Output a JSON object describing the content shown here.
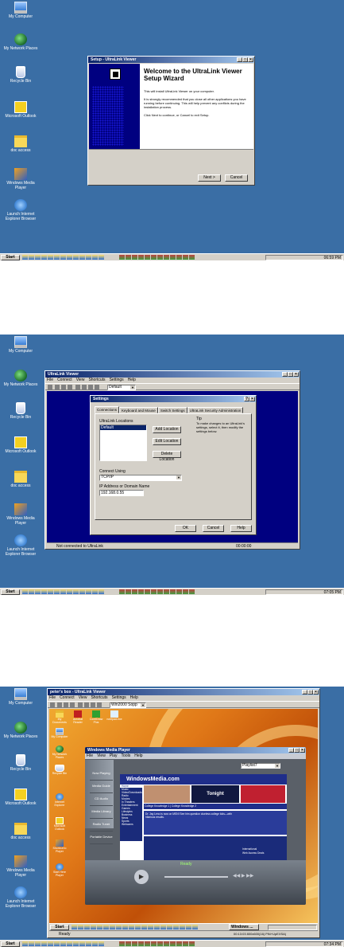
{
  "desktop_icons": [
    "My Computer",
    "My Network Places",
    "Recycle Bin",
    "Microsoft Outlook",
    "doc access",
    "Windows Media Player",
    "Launch Internet Explorer Browser"
  ],
  "taskbar": {
    "start_label": "Start"
  },
  "shot1": {
    "clock": "06:59 PM",
    "wizard": {
      "title": "Setup - UltraLink Viewer",
      "heading": "Welcome to the UltraLink Viewer Setup Wizard",
      "p1": "This will install UltraLink Viewer on your computer.",
      "p2": "It is strongly recommended that you close all other applications you have running before continuing. This will help prevent any conflicts during the installation process.",
      "p3": "Click Next to continue, or Cancel to exit Setup.",
      "next_label": "Next >",
      "cancel_label": "Cancel"
    }
  },
  "shot2": {
    "clock": "07:05 PM",
    "viewer": {
      "title": "UltraLink Viewer",
      "menu": [
        "File",
        "Connect",
        "View",
        "Shortcuts",
        "Settings",
        "Help"
      ],
      "location_combo": "Default",
      "status": "Not connected to UltraLink",
      "timer": "00:00:00"
    },
    "settings": {
      "title": "Settings",
      "tabs": [
        "Connections",
        "Keyboard and Mouse",
        "Switch Settings",
        "UltraLink Security Administration"
      ],
      "locations_label": "UltraLink Locations",
      "locations": [
        "Default"
      ],
      "add_label": "Add Location",
      "edit_label": "Edit Location",
      "delete_label": "Delete Location",
      "tip_title": "Tip",
      "tip_text": "To make changes to an UltraLink's settings, select it, then modify the settings below.",
      "connect_using_label": "Connect Using",
      "connect_using_value": "TCP/IP",
      "ip_label": "IP Address or Domain Name",
      "ip_value": "192.168.0.55",
      "ok_label": "OK",
      "cancel_label": "Cancel",
      "help_label": "Help"
    }
  },
  "shot3": {
    "clock": "07:34 PM",
    "viewer": {
      "title": "peter's box - UltraLink Viewer",
      "menu": [
        "File",
        "Connect",
        "View",
        "Shortcuts",
        "Settings",
        "Help"
      ],
      "location_combo": "Win2000 Sopp",
      "status": "Ready",
      "status_right": "00:13:03  800x600(16)  PiN+UpEXSA)"
    },
    "remote_icons": [
      "My Documents",
      "Acrobat Reader",
      "CorelDraw Plus",
      "notepad.exe",
      "My Computer",
      "My Network Places",
      "Recycle Bin",
      "Internet Explorer",
      "Microsoft Outlook",
      "Shortcut to Player",
      "Start Here Player"
    ],
    "wmp": {
      "title": "Windows Media Player",
      "menu": [
        "File",
        "View",
        "Play",
        "Tools",
        "Help"
      ],
      "playlist": "Playlist7",
      "side_tabs": [
        "Now Playing",
        "Media Guide",
        "CD Audio",
        "Media Library",
        "Radio Tuner",
        "Portable Device"
      ],
      "status": "Ready",
      "site": "WindowsMedia.com",
      "nav": [
        "Home",
        "Music",
        "Video/Downloads",
        "Radio",
        "Movies",
        "In Theaters",
        "Entertainment",
        "Games",
        "Lifestyles",
        "Business",
        "News",
        "Sports",
        "Webcams"
      ],
      "promo_tonight": "Tonight",
      "headline1": "Dr. Jay Leno is now on MSN! See him question clueless college kids—with hilarious results.",
      "headline2": "College Knowledge 1 | College Knowledge 2",
      "international": "International",
      "web_access": "Web Access Deals"
    },
    "remote_taskbar_windows": "Windows ..."
  }
}
